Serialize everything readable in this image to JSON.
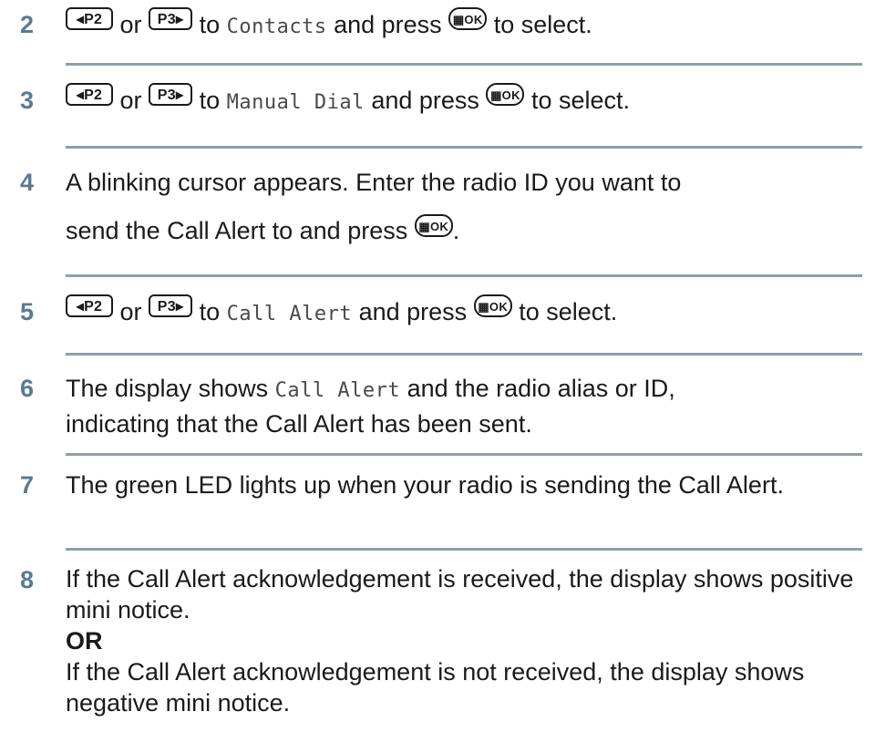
{
  "keys": {
    "p2": "◂P2",
    "p3": "P3▸",
    "ok": "▦OK"
  },
  "steps": [
    {
      "num": "2",
      "or": "or",
      "to": "to",
      "menu": "Contacts",
      "after": "and press",
      "end": "to select."
    },
    {
      "num": "3",
      "or": "or",
      "to": "to",
      "menu": "Manual Dial",
      "after": "and press",
      "end": "to select."
    },
    {
      "num": "4",
      "line1": "A blinking cursor appears. Enter the radio ID you want to",
      "line2": "send the Call Alert to and press",
      "end": "."
    },
    {
      "num": "5",
      "or": "or",
      "to": "to",
      "menu": "Call Alert",
      "after": "and press",
      "end": "to select."
    },
    {
      "num": "6",
      "pre": "The display shows",
      "menu": "Call Alert",
      "post": "and the radio alias or ID,",
      "line2": "indicating that the Call Alert has been sent."
    },
    {
      "num": "7",
      "text": "The green LED lights up when your radio is sending the Call Alert."
    },
    {
      "num": "8",
      "para1": "If the Call Alert acknowledgement is received, the display shows positive mini notice.",
      "or": "OR",
      "para2": "If the Call Alert acknowledgement is not received, the display shows negative mini notice."
    }
  ]
}
